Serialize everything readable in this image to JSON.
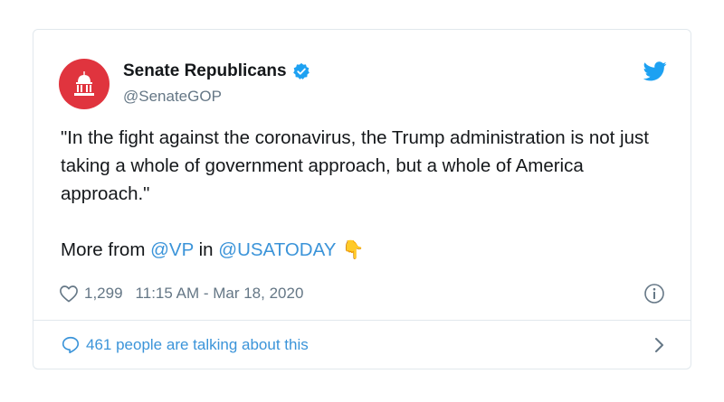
{
  "account": {
    "display_name": "Senate Republicans",
    "handle": "@SenateGOP"
  },
  "tweet": {
    "text": "\"In the fight against the coronavirus, the Trump administration is not just taking a whole of government approach, but a whole of America approach.\"",
    "more_prefix": "More from ",
    "mention_vp": "@VP",
    "more_middle": " in ",
    "mention_usatoday": "@USATODAY",
    "emoji": "👇"
  },
  "meta": {
    "likes": "1,299",
    "timestamp": "11:15 AM - Mar 18, 2020"
  },
  "footer": {
    "conversation_label": "461 people are talking about this"
  },
  "colors": {
    "avatar_red": "#e0343e",
    "link_blue": "#3b94d9",
    "twitter_blue": "#1da1f2",
    "muted_gray": "#657786"
  },
  "icons": {
    "avatar": "capitol-dome-icon",
    "verified": "verified-badge-icon",
    "brand": "twitter-bird-icon",
    "like": "heart-icon",
    "info": "info-icon",
    "conversation": "speech-bubble-icon",
    "navigate": "chevron-right-icon"
  }
}
